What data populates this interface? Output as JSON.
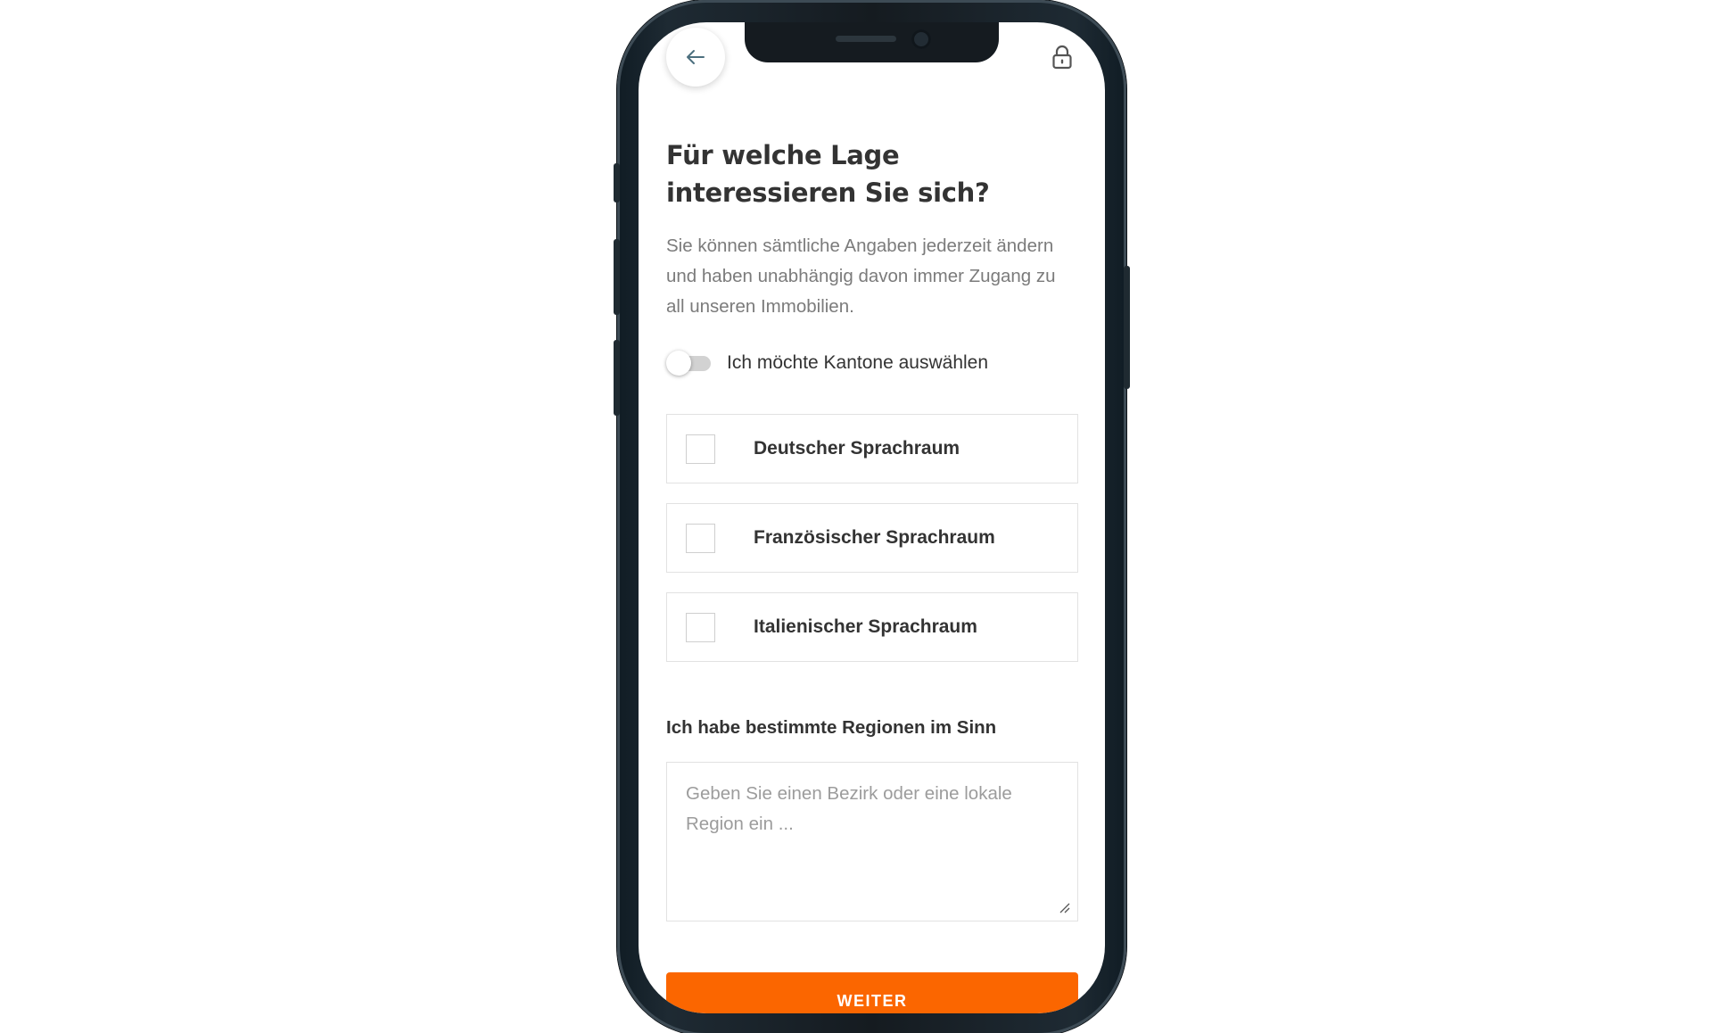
{
  "header": {
    "back_icon": "arrow-left-icon",
    "lock_icon": "lock-icon"
  },
  "main": {
    "title": "Für welche Lage interessieren Sie sich?",
    "subtitle": "Sie können sämtliche Angaben jederzeit ändern und haben unabhängig davon immer Zugang zu all unseren Immobilien.",
    "toggle": {
      "label": "Ich möchte Kantone auswählen",
      "checked": false
    },
    "options": [
      {
        "label": "Deutscher Sprachraum",
        "checked": false
      },
      {
        "label": "Französischer Sprachraum",
        "checked": false
      },
      {
        "label": "Italienischer Sprachraum",
        "checked": false
      }
    ],
    "regions": {
      "label": "Ich habe bestimmte Regionen im Sinn",
      "placeholder": "Geben Sie einen Bezirk oder eine lokale Region ein ...",
      "value": ""
    },
    "submit_label": "WEITER"
  },
  "colors": {
    "accent": "#fb6600",
    "text": "#333333",
    "muted": "#7b7b7b",
    "border": "#e2e2e2",
    "frame": "#151b20"
  }
}
